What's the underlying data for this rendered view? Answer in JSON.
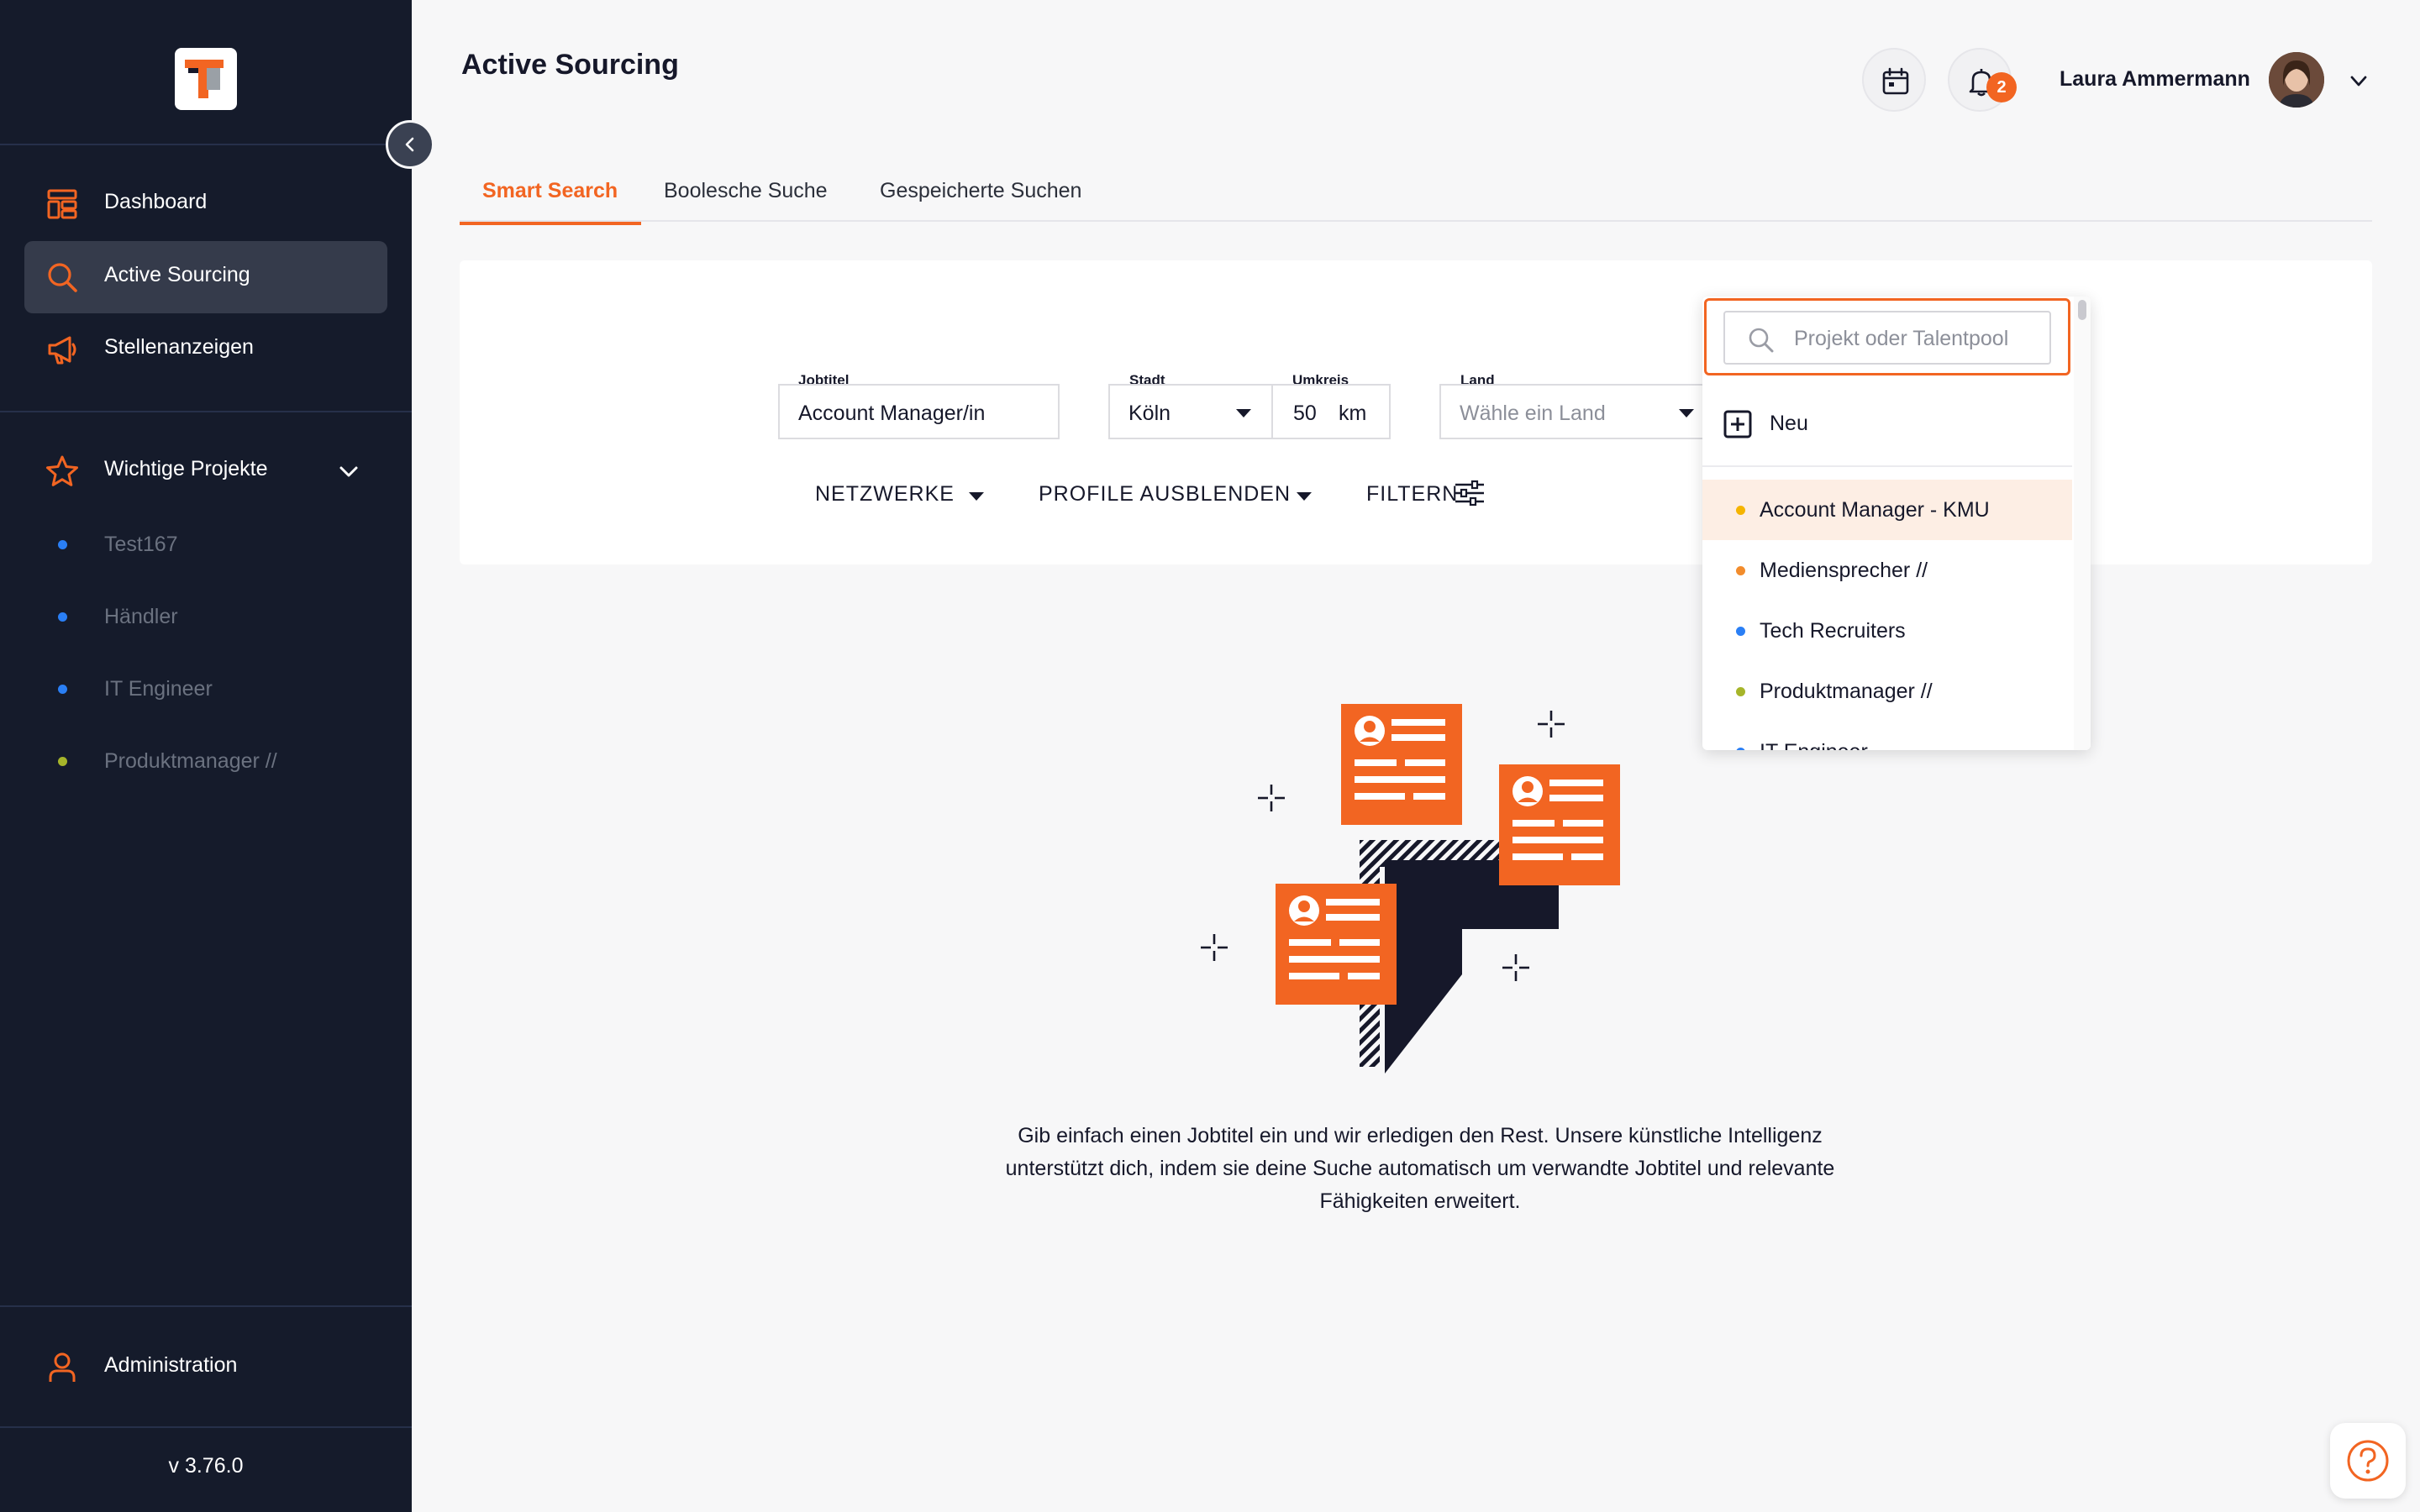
{
  "app": {
    "page_title": "Active Sourcing",
    "brand_color": "#f26522",
    "version": "v 3.76.0"
  },
  "sidebar": {
    "nav": [
      {
        "label": "Dashboard",
        "icon": "layout-icon"
      },
      {
        "label": "Active Sourcing",
        "icon": "search-icon",
        "active": true
      },
      {
        "label": "Stellenanzeigen",
        "icon": "megaphone-icon"
      }
    ],
    "favorites": {
      "label": "Wichtige Projekte",
      "icon": "star-icon",
      "projects": [
        {
          "label": "Test167",
          "color": "#2a7ff5"
        },
        {
          "label": "Händler",
          "color": "#2a7ff5"
        },
        {
          "label": "IT Engineer",
          "color": "#2a7ff5"
        },
        {
          "label": "Produktmanager //",
          "color": "#a6b52a"
        }
      ]
    },
    "admin": {
      "label": "Administration",
      "icon": "user-icon"
    }
  },
  "header": {
    "user_name": "Laura Ammermann",
    "notification_count": "2"
  },
  "tabs": [
    {
      "label": "Smart Search",
      "active": true
    },
    {
      "label": "Boolesche Suche"
    },
    {
      "label": "Gespeicherte Suchen"
    }
  ],
  "search": {
    "jobtitle": {
      "label": "Jobtitel",
      "value": "Account Manager/in"
    },
    "city": {
      "label": "Stadt",
      "value": "Köln"
    },
    "radius": {
      "label": "Umkreis",
      "value": "50",
      "unit": "km"
    },
    "country": {
      "label": "Land",
      "placeholder": "Wähle ein Land"
    },
    "actions": {
      "networks": "NETZWERKE",
      "hide_profiles": "PROFILE AUSBLENDEN",
      "filter": "FILTERN"
    }
  },
  "dropdown": {
    "placeholder": "Projekt oder Talentpool",
    "new_label": "Neu",
    "items": [
      {
        "label": "Account Manager - KMU",
        "color": "#f5b400",
        "highlighted": true
      },
      {
        "label": "Mediensprecher //",
        "color": "#f28c2c"
      },
      {
        "label": "Tech Recruiters",
        "color": "#2a7ff5"
      },
      {
        "label": "Produktmanager //",
        "color": "#a6b52a"
      },
      {
        "label": "IT Engineer",
        "color": "#2a7ff5"
      }
    ]
  },
  "empty_state": {
    "description": "Gib einfach einen Jobtitel ein und wir erledigen den Rest. Unsere künstliche Intelligenz unterstützt dich, indem sie deine Suche automatisch um verwandte Jobtitel und relevante Fähigkeiten erweitert."
  }
}
